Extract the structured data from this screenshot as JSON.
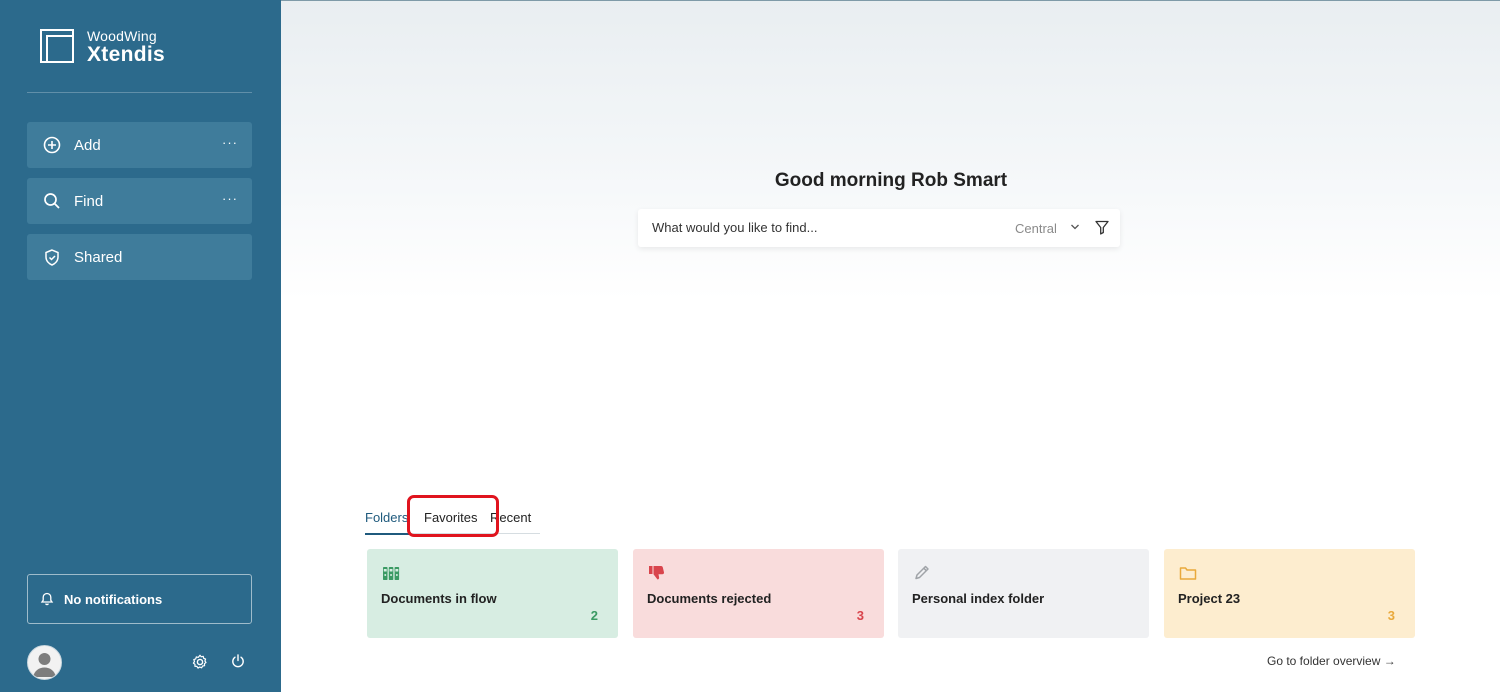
{
  "sidebar": {
    "logo": {
      "line1": "WoodWing",
      "line2": "Xtendis"
    },
    "nav": [
      {
        "label": "Add",
        "icon": "plus-circle-icon",
        "more": "···"
      },
      {
        "label": "Find",
        "icon": "search-icon",
        "more": "···"
      },
      {
        "label": "Shared",
        "icon": "shield-icon"
      }
    ],
    "notifications": {
      "label": "No notifications",
      "icon": "bell-icon"
    },
    "footer": {
      "avatar": "user-avatar-icon",
      "settings": "gear-icon",
      "logout": "power-icon"
    }
  },
  "main": {
    "greeting": "Good morning Rob Smart",
    "search": {
      "placeholder": "What would you like to find...",
      "scope": "Central"
    },
    "tabs": [
      {
        "label": "Folders",
        "active": true
      },
      {
        "label": "Favorites",
        "active": false
      },
      {
        "label": "Recent",
        "active": false
      }
    ],
    "cards": [
      {
        "title": "Documents in flow",
        "count": "2",
        "icon": "binders-icon",
        "bg": "#d7ede2",
        "accent": "#3a9a63"
      },
      {
        "title": "Documents rejected",
        "count": "3",
        "icon": "thumbs-down-icon",
        "bg": "#f9dcdc",
        "accent": "#d9444c"
      },
      {
        "title": "Personal index folder",
        "count": "",
        "icon": "pencil-icon",
        "bg": "#f0f1f3",
        "accent": "#a0a4a8"
      },
      {
        "title": "Project 23",
        "count": "3",
        "icon": "folder-icon",
        "bg": "#fdedcf",
        "accent": "#e9a93b"
      }
    ],
    "footer_link": "Go to folder overview →"
  },
  "colors": {
    "sidebar": "#2c6a8c",
    "nav_item": "#3f7c9b",
    "highlight": "#e0141e"
  }
}
